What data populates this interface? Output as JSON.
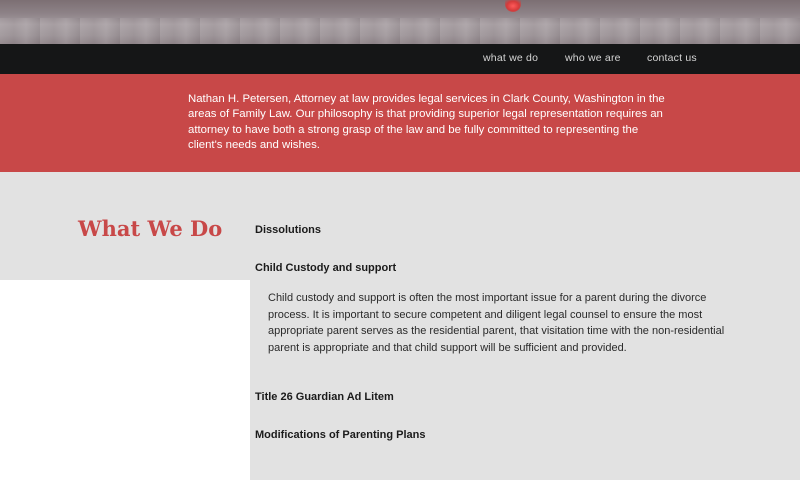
{
  "nav": {
    "items": [
      {
        "label": "what we do"
      },
      {
        "label": "who we are"
      },
      {
        "label": "contact us"
      }
    ]
  },
  "intro": {
    "text": "Nathan H. Petersen, Attorney at law provides legal services in Clark County, Washington in the areas of Family Law. Our philosophy is that providing superior legal representation requires an attorney to have both a strong grasp of the law and be fully committed to representing the client's needs and wishes."
  },
  "what_we_do": {
    "title": "What We Do",
    "services": [
      {
        "heading": "Dissolutions"
      },
      {
        "heading": "Child Custody and support",
        "description": "Child custody and support is often the most important issue for a parent during the divorce process. It is important to secure competent and diligent legal counsel to ensure the most appropriate parent serves as the residential parent, that visitation time with the non-residential parent is appropriate and that child support will be sufficient and provided."
      },
      {
        "heading": "Title 26 Guardian Ad Litem"
      },
      {
        "heading": "Modifications of Parenting Plans"
      }
    ]
  },
  "colors": {
    "accent_red": "#c84848",
    "navbar_bg": "#151617",
    "content_bg": "#e2e2e2"
  }
}
